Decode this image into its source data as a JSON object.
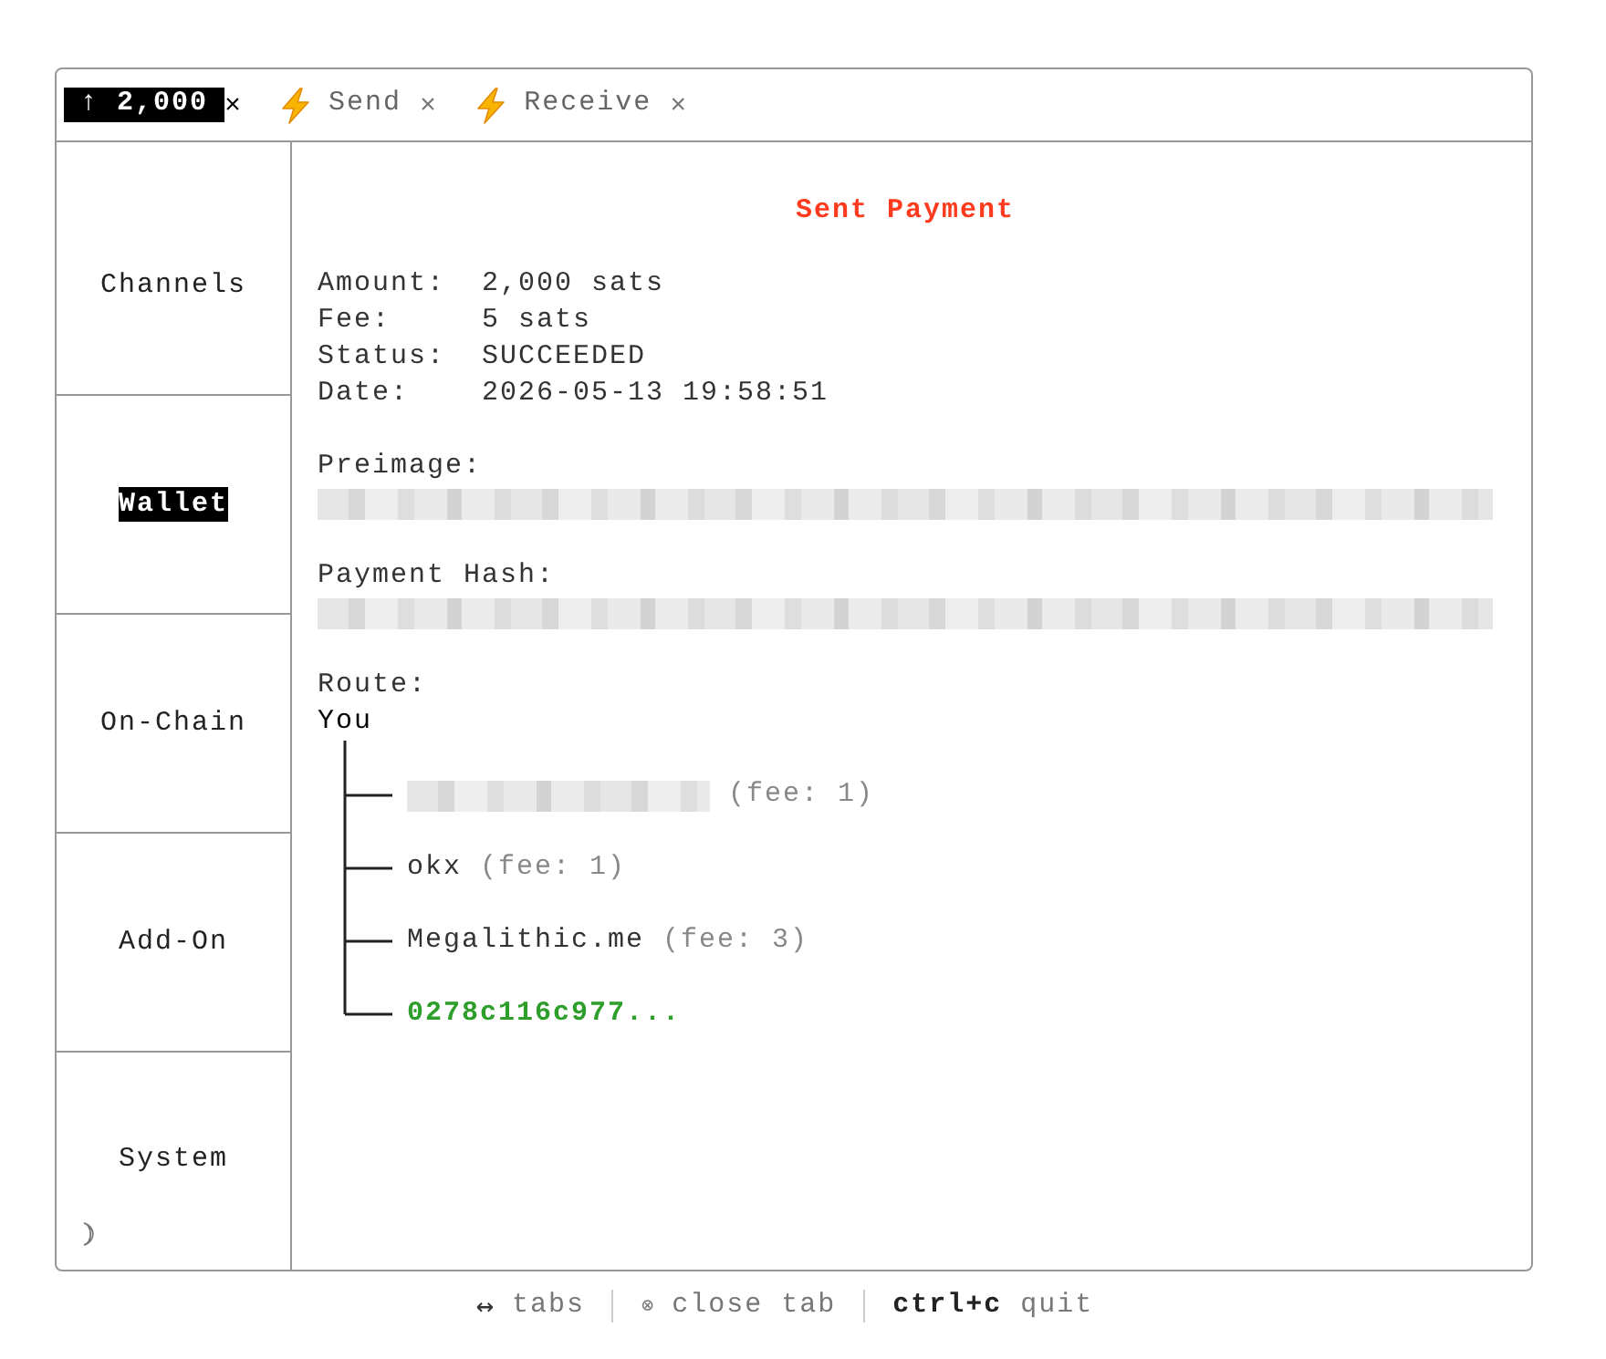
{
  "tabs": [
    {
      "kind": "amount",
      "label": "↑ 2,000",
      "close": "×",
      "selected": true
    },
    {
      "kind": "action",
      "label": "Send",
      "close": "×",
      "selected": false
    },
    {
      "kind": "action",
      "label": "Receive",
      "close": "×",
      "selected": false
    }
  ],
  "sidebar": {
    "items": [
      {
        "label": "Channels",
        "selected": false
      },
      {
        "label": "Wallet",
        "selected": true
      },
      {
        "label": "On-Chain",
        "selected": false
      },
      {
        "label": "Add-On",
        "selected": false
      },
      {
        "label": "System",
        "selected": false
      }
    ]
  },
  "payment": {
    "title": "Sent Payment",
    "fields": [
      {
        "label": "Amount:",
        "value": "2,000 sats"
      },
      {
        "label": "Fee:",
        "value": "5 sats"
      },
      {
        "label": "Status:",
        "value": "SUCCEEDED"
      },
      {
        "label": "Date:",
        "value": "2026-05-13 19:58:51"
      }
    ],
    "preimage": {
      "label": "Preimage:",
      "redacted": true
    },
    "payment_hash": {
      "label": "Payment Hash:",
      "redacted": true
    },
    "route": {
      "label": "Route:",
      "origin": "You",
      "hops": [
        {
          "kind": "hop",
          "redacted": true,
          "fee": "(fee: 1)"
        },
        {
          "kind": "hop",
          "redacted": false,
          "name": "okx",
          "fee": "(fee: 1)"
        },
        {
          "kind": "hop",
          "redacted": false,
          "name": "Megalithic.me",
          "fee": "(fee: 3)"
        },
        {
          "kind": "destination",
          "redacted": false,
          "name": "0278c116c977..."
        }
      ]
    }
  },
  "footer": {
    "hints": [
      {
        "kind": "arrow",
        "key": "↔",
        "action": "tabs"
      },
      {
        "kind": "symbol",
        "key": "⊗",
        "action": "close tab"
      },
      {
        "kind": "combo",
        "key": "ctrl+c",
        "action": "quit"
      }
    ]
  }
}
